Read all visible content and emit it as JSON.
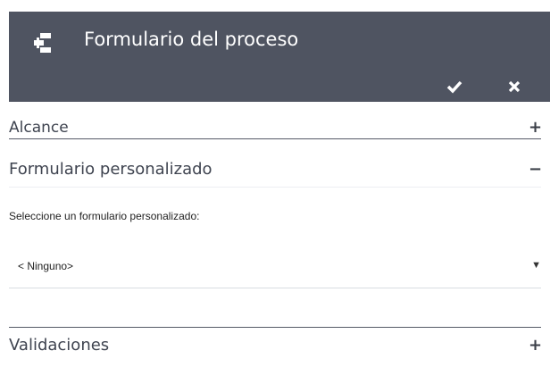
{
  "header": {
    "title": "Formulario del proceso",
    "icon": "process-tree-icon",
    "accept_icon": "check-icon",
    "close_icon": "close-icon",
    "background": "#4f5461"
  },
  "sections": [
    {
      "label": "Alcance",
      "toggle": "+",
      "expanded": false
    },
    {
      "label": "Formulario personalizado",
      "toggle": "−",
      "expanded": true
    },
    {
      "label": "Validaciones",
      "toggle": "+",
      "expanded": false
    }
  ],
  "form": {
    "field_label": "Seleccione un formulario personalizado:",
    "selected_value": "< Ninguno>",
    "dropdown_arrow": "▼"
  }
}
